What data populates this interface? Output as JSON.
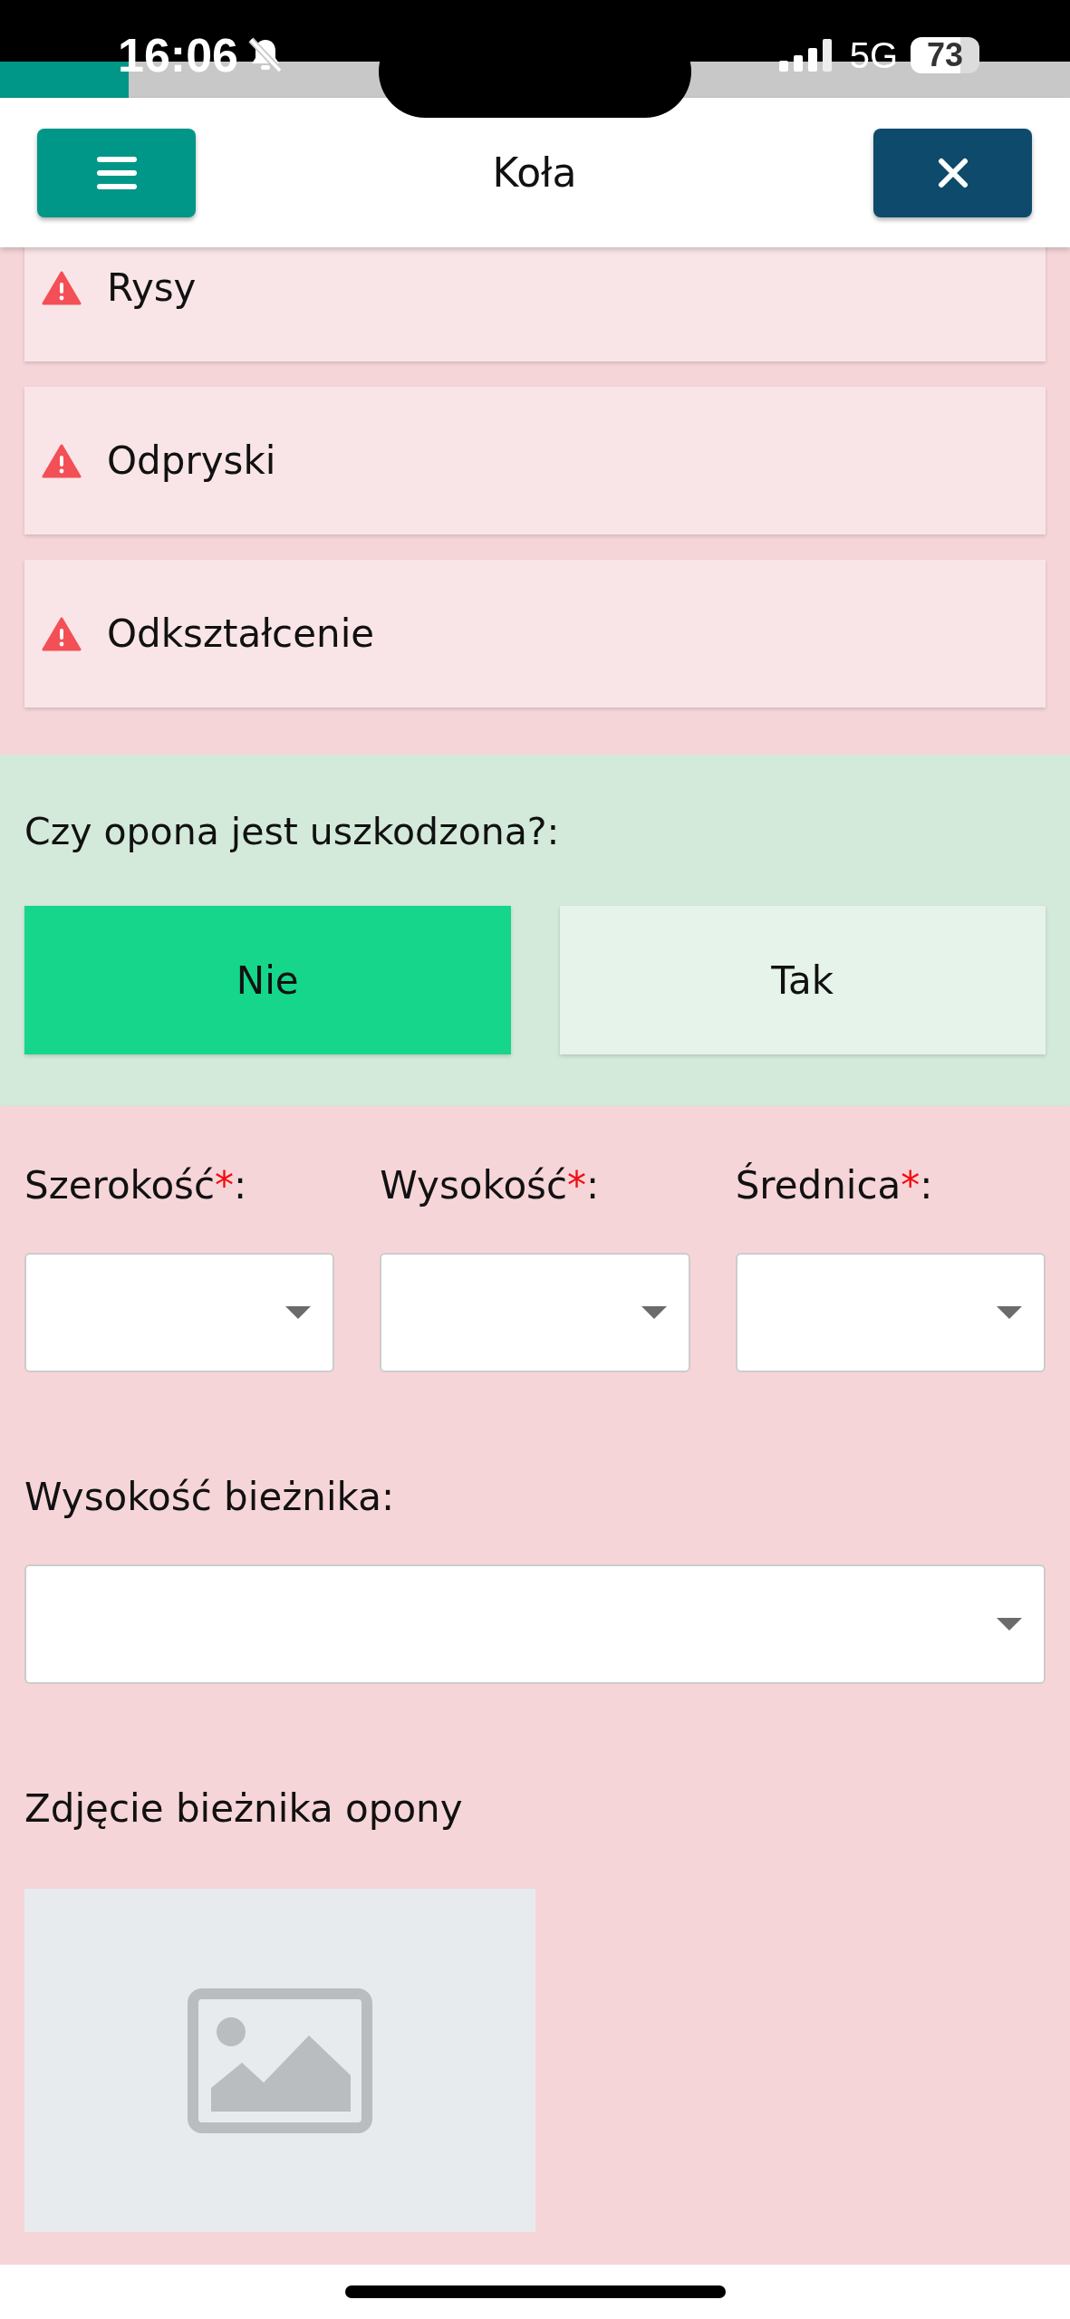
{
  "status_bar": {
    "time": "16:06",
    "network": "5G",
    "battery": "73"
  },
  "load_progress": {
    "level": 0.12
  },
  "header": {
    "title": "Koła"
  },
  "damage_items": [
    {
      "label": "Rysy"
    },
    {
      "label": "Odpryski"
    },
    {
      "label": "Odkształcenie"
    }
  ],
  "question": {
    "text": "Czy opona jest uszkodzona?:",
    "options": [
      {
        "label": "Nie",
        "selected": true
      },
      {
        "label": "Tak",
        "selected": false
      }
    ]
  },
  "size_fields": [
    {
      "label": "Szerokość",
      "mark": "*",
      "suffix": ":"
    },
    {
      "label": "Wysokość",
      "mark": "*",
      "suffix": ":"
    },
    {
      "label": "Średnica",
      "mark": "*",
      "suffix": ":"
    }
  ],
  "tread_depth": {
    "label": "Wysokość bieżnika:"
  },
  "photo": {
    "label": "Zdjęcie bieżnika opony",
    "kind": "placeholder"
  }
}
